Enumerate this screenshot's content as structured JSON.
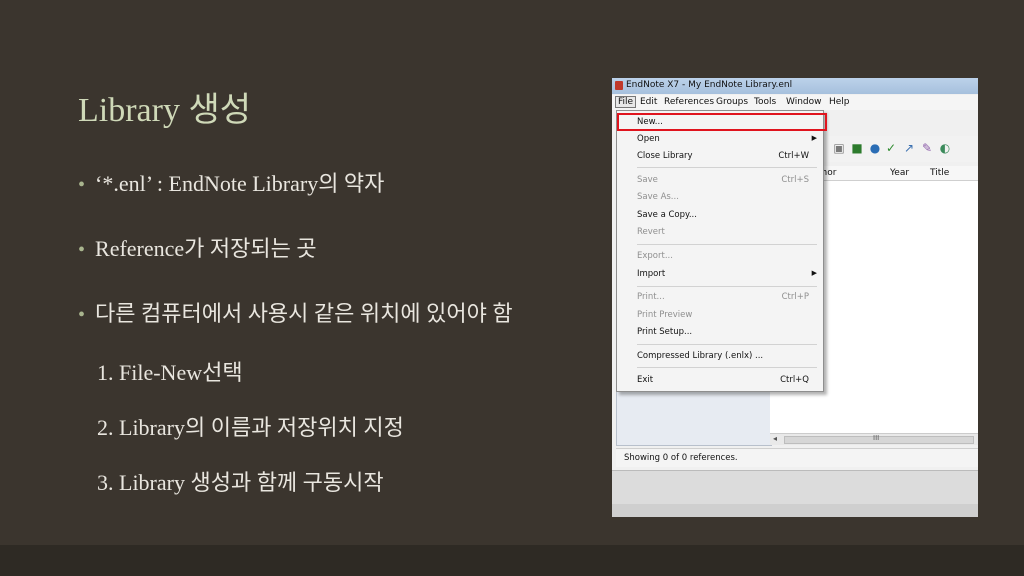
{
  "slide": {
    "title": "Library 생성",
    "bullets": [
      "‘*.enl’ : EndNote Library의 약자",
      "Reference가 저장되는 곳",
      "다른 컴퓨터에서 사용시 같은 위치에 있어야 함"
    ],
    "steps": [
      "1. File-New선택",
      "2. Library의 이름과 저장위치 지정",
      "3. Library 생성과 함께 구동시작"
    ]
  },
  "app": {
    "window_title": "EndNote X7 - My EndNote Library.enl",
    "menu": [
      "File",
      "Edit",
      "References",
      "Groups",
      "Tools",
      "Window",
      "Help"
    ],
    "file_menu": {
      "new": "New...",
      "open": "Open",
      "close_library": "Close Library",
      "close_library_shortcut": "Ctrl+W",
      "save": "Save",
      "save_shortcut": "Ctrl+S",
      "save_as": "Save As...",
      "save_copy": "Save a Copy...",
      "revert": "Revert",
      "export": "Export...",
      "import": "Import",
      "print": "Print...",
      "print_shortcut": "Ctrl+P",
      "print_preview": "Print Preview",
      "print_setup": "Print Setup...",
      "compressed_library": "Compressed Library (.enlx) ...",
      "exit": "Exit",
      "exit_shortcut": "Ctrl+Q"
    },
    "columns": [
      "thor",
      "Year",
      "Title"
    ],
    "scroll_marker": "III",
    "status": "Showing 0 of 0 references.",
    "colors": {
      "highlight": "#e0141e",
      "title_color": "#cfd9b8",
      "background": "#3b352e"
    }
  }
}
